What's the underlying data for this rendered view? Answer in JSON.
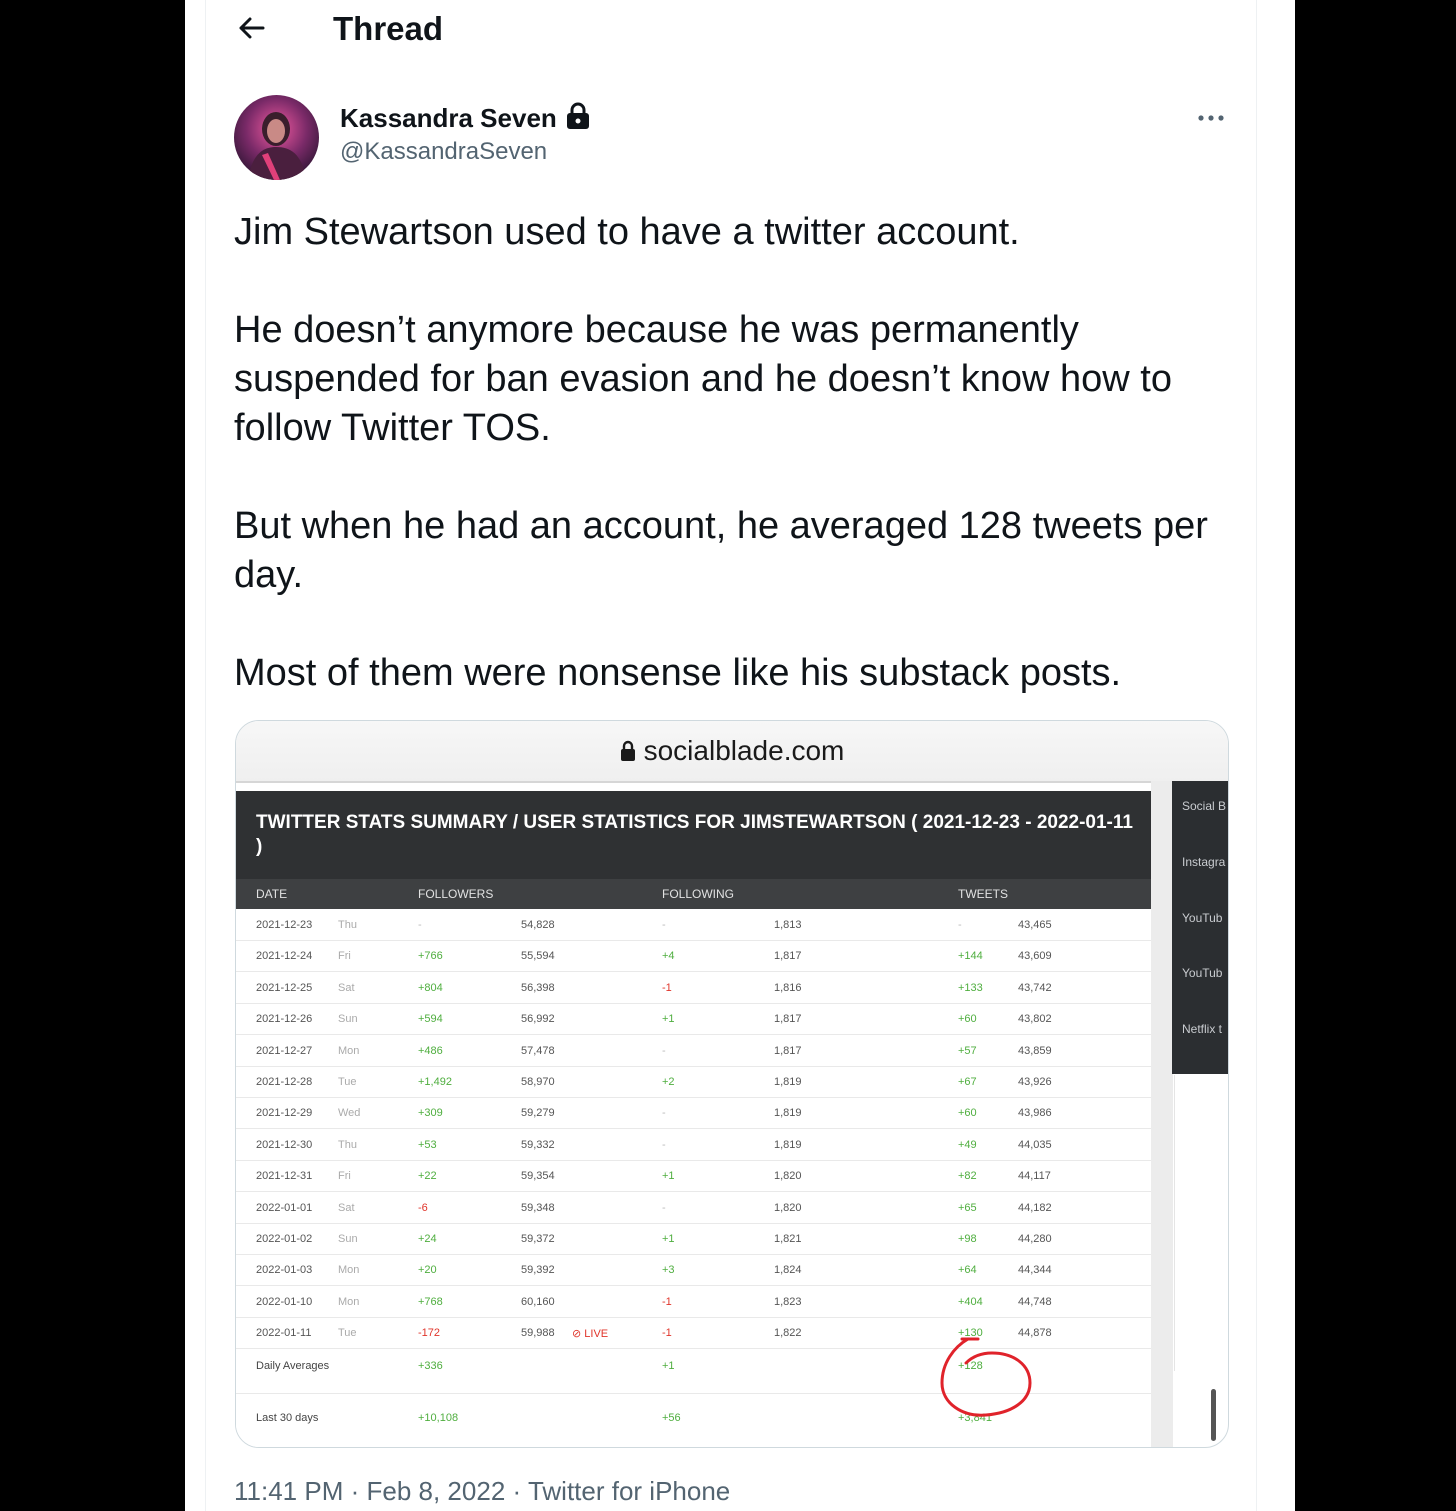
{
  "header": {
    "title": "Thread",
    "back_icon": "arrow-left-icon"
  },
  "author": {
    "display_name": "Kassandra Seven",
    "handle": "@KassandraSeven",
    "protected_icon": "lock-icon"
  },
  "tweet": {
    "paragraphs": [
      "Jim Stewartson used to have a twitter account.",
      "He doesn’t anymore because he was permanently suspended for ban evasion and he doesn’t know how to follow Twitter TOS.",
      "But when he had an account, he averaged 128 tweets per day.",
      "Most of them were nonsense like his substack posts."
    ],
    "time": "11:41 PM",
    "date": "Feb 8, 2022",
    "source": "Twitter for iPhone",
    "separator": "·"
  },
  "screenshot": {
    "url": "socialblade.com",
    "title": "TWITTER STATS SUMMARY / USER STATISTICS FOR JIMSTEWARTSON ( 2021-12-23 - 2022-01-11 )",
    "columns": [
      "DATE",
      "FOLLOWERS",
      "FOLLOWING",
      "TWEETS"
    ],
    "sidebar_items": [
      "Social B",
      "Instagra",
      "YouTub",
      "YouTub",
      "Netflix t"
    ],
    "rows": [
      {
        "date": "2021-12-23",
        "dow": "Thu",
        "fol_delta": "-",
        "fol": "54,828",
        "fing_delta": "-",
        "fing": "1,813",
        "tw_delta": "-",
        "tw": "43,465"
      },
      {
        "date": "2021-12-24",
        "dow": "Fri",
        "fol_delta": "+766",
        "fol": "55,594",
        "fing_delta": "+4",
        "fing": "1,817",
        "tw_delta": "+144",
        "tw": "43,609"
      },
      {
        "date": "2021-12-25",
        "dow": "Sat",
        "fol_delta": "+804",
        "fol": "56,398",
        "fing_delta": "-1",
        "fing": "1,816",
        "tw_delta": "+133",
        "tw": "43,742"
      },
      {
        "date": "2021-12-26",
        "dow": "Sun",
        "fol_delta": "+594",
        "fol": "56,992",
        "fing_delta": "+1",
        "fing": "1,817",
        "tw_delta": "+60",
        "tw": "43,802"
      },
      {
        "date": "2021-12-27",
        "dow": "Mon",
        "fol_delta": "+486",
        "fol": "57,478",
        "fing_delta": "-",
        "fing": "1,817",
        "tw_delta": "+57",
        "tw": "43,859"
      },
      {
        "date": "2021-12-28",
        "dow": "Tue",
        "fol_delta": "+1,492",
        "fol": "58,970",
        "fing_delta": "+2",
        "fing": "1,819",
        "tw_delta": "+67",
        "tw": "43,926"
      },
      {
        "date": "2021-12-29",
        "dow": "Wed",
        "fol_delta": "+309",
        "fol": "59,279",
        "fing_delta": "-",
        "fing": "1,819",
        "tw_delta": "+60",
        "tw": "43,986"
      },
      {
        "date": "2021-12-30",
        "dow": "Thu",
        "fol_delta": "+53",
        "fol": "59,332",
        "fing_delta": "-",
        "fing": "1,819",
        "tw_delta": "+49",
        "tw": "44,035"
      },
      {
        "date": "2021-12-31",
        "dow": "Fri",
        "fol_delta": "+22",
        "fol": "59,354",
        "fing_delta": "+1",
        "fing": "1,820",
        "tw_delta": "+82",
        "tw": "44,117"
      },
      {
        "date": "2022-01-01",
        "dow": "Sat",
        "fol_delta": "-6",
        "fol": "59,348",
        "fing_delta": "-",
        "fing": "1,820",
        "tw_delta": "+65",
        "tw": "44,182"
      },
      {
        "date": "2022-01-02",
        "dow": "Sun",
        "fol_delta": "+24",
        "fol": "59,372",
        "fing_delta": "+1",
        "fing": "1,821",
        "tw_delta": "+98",
        "tw": "44,280"
      },
      {
        "date": "2022-01-03",
        "dow": "Mon",
        "fol_delta": "+20",
        "fol": "59,392",
        "fing_delta": "+3",
        "fing": "1,824",
        "tw_delta": "+64",
        "tw": "44,344"
      },
      {
        "date": "2022-01-10",
        "dow": "Mon",
        "fol_delta": "+768",
        "fol": "60,160",
        "fing_delta": "-1",
        "fing": "1,823",
        "tw_delta": "+404",
        "tw": "44,748"
      },
      {
        "date": "2022-01-11",
        "dow": "Tue",
        "fol_delta": "-172",
        "fol": "59,988",
        "fing_delta": "-1",
        "fing": "1,822",
        "tw_delta": "+130",
        "tw": "44,878",
        "live": "LIVE"
      }
    ],
    "daily_averages": {
      "label": "Daily Averages",
      "fol": "+336",
      "fing": "+1",
      "tw": "+128"
    },
    "last_30_days": {
      "label": "Last 30 days",
      "fol": "+10,108",
      "fing": "+56",
      "tw": "+3,841"
    },
    "colors": {
      "positive": "#4fae3f",
      "negative": "#e0352b",
      "header_bg": "#2f3133",
      "annotation": "#e0232b"
    }
  }
}
